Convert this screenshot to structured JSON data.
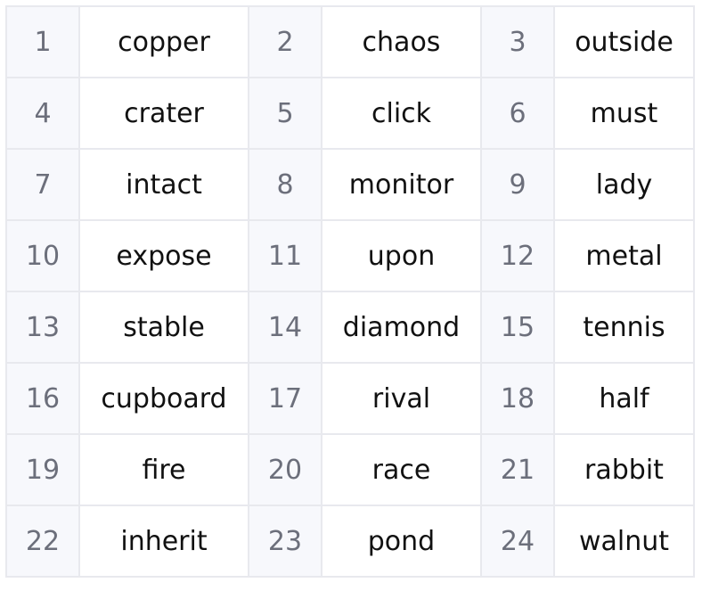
{
  "rows": [
    [
      {
        "n": "1",
        "w": "copper"
      },
      {
        "n": "2",
        "w": "chaos"
      },
      {
        "n": "3",
        "w": "outside"
      }
    ],
    [
      {
        "n": "4",
        "w": "crater"
      },
      {
        "n": "5",
        "w": "click"
      },
      {
        "n": "6",
        "w": "must"
      }
    ],
    [
      {
        "n": "7",
        "w": "intact"
      },
      {
        "n": "8",
        "w": "monitor"
      },
      {
        "n": "9",
        "w": "lady"
      }
    ],
    [
      {
        "n": "10",
        "w": "expose"
      },
      {
        "n": "11",
        "w": "upon"
      },
      {
        "n": "12",
        "w": "metal"
      }
    ],
    [
      {
        "n": "13",
        "w": "stable"
      },
      {
        "n": "14",
        "w": "diamond"
      },
      {
        "n": "15",
        "w": "tennis"
      }
    ],
    [
      {
        "n": "16",
        "w": "cupboard"
      },
      {
        "n": "17",
        "w": "rival"
      },
      {
        "n": "18",
        "w": "half"
      }
    ],
    [
      {
        "n": "19",
        "w": "fire"
      },
      {
        "n": "20",
        "w": "race"
      },
      {
        "n": "21",
        "w": "rabbit"
      }
    ],
    [
      {
        "n": "22",
        "w": "inherit"
      },
      {
        "n": "23",
        "w": "pond"
      },
      {
        "n": "24",
        "w": "walnut"
      }
    ]
  ]
}
